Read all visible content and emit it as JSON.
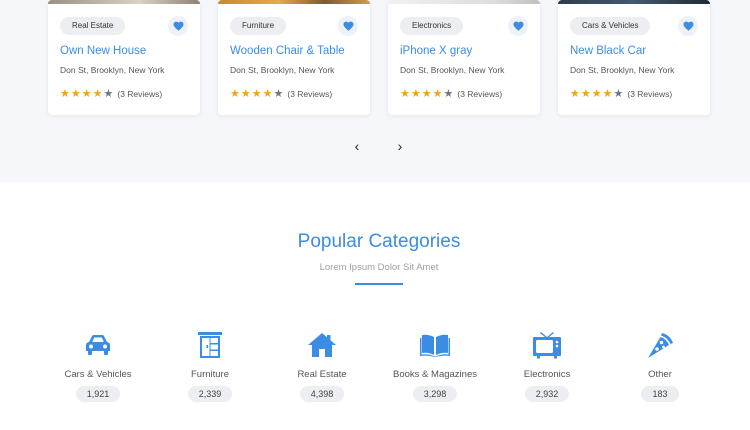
{
  "listings": [
    {
      "category": "Real Estate",
      "title": "Own New House",
      "address": "Don St, Brooklyn, New York",
      "rating": 4,
      "reviews": "(3 Reviews)",
      "image": "house"
    },
    {
      "category": "Furniture",
      "title": "Wooden Chair & Table",
      "address": "Don St, Brooklyn, New York",
      "rating": 4,
      "reviews": "(3 Reviews)",
      "image": "chair"
    },
    {
      "category": "Electronics",
      "title": "iPhone X gray",
      "address": "Don St, Brooklyn, New York",
      "rating": 4,
      "reviews": "(3 Reviews)",
      "image": "phone"
    },
    {
      "category": "Cars & Vehicles",
      "title": "New Black Car",
      "address": "Don St, Brooklyn, New York",
      "rating": 4,
      "reviews": "(3 Reviews)",
      "image": "car"
    }
  ],
  "pager": {
    "prev_icon": "chevron-left-icon",
    "prev": "‹",
    "next_icon": "chevron-right-icon",
    "next": "›"
  },
  "popular": {
    "title": "Popular Categories",
    "subtitle": "Lorem Ipsum Dolor Sit Amet",
    "categories": [
      {
        "label": "Cars & Vehicles",
        "count": "1,921",
        "icon": "car-icon"
      },
      {
        "label": "Furniture",
        "count": "2,339",
        "icon": "wardrobe-icon"
      },
      {
        "label": "Real Estate",
        "count": "4,398",
        "icon": "house-icon"
      },
      {
        "label": "Books & Magazines",
        "count": "3,298",
        "icon": "book-icon"
      },
      {
        "label": "Electronics",
        "count": "2,932",
        "icon": "tv-icon"
      },
      {
        "label": "Other",
        "count": "183",
        "icon": "pizza-icon"
      }
    ]
  },
  "colors": {
    "accent": "#3b8de4",
    "star": "#f4a218",
    "star_off": "#6c7580",
    "band": "#f6f7fb"
  }
}
